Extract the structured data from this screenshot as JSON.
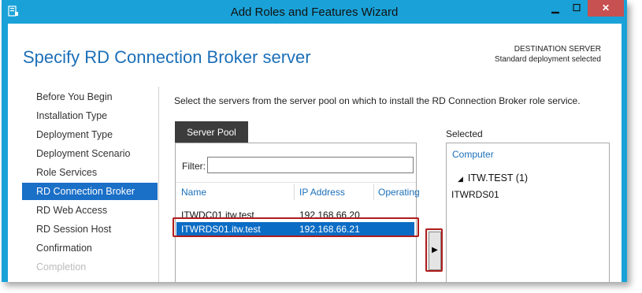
{
  "window": {
    "title": "Add Roles and Features Wizard",
    "minimize_glyph": "▁",
    "maximize_glyph": "☐",
    "close_glyph": "✕"
  },
  "page": {
    "heading": "Specify RD Connection Broker server",
    "destination_label": "DESTINATION SERVER",
    "destination_value": "Standard deployment selected"
  },
  "nav": {
    "items": [
      {
        "label": "Before You Begin",
        "state": "normal"
      },
      {
        "label": "Installation Type",
        "state": "normal"
      },
      {
        "label": "Deployment Type",
        "state": "normal"
      },
      {
        "label": "Deployment Scenario",
        "state": "normal"
      },
      {
        "label": "Role Services",
        "state": "normal"
      },
      {
        "label": "RD Connection Broker",
        "state": "active"
      },
      {
        "label": "RD Web Access",
        "state": "normal"
      },
      {
        "label": "RD Session Host",
        "state": "normal"
      },
      {
        "label": "Confirmation",
        "state": "normal"
      },
      {
        "label": "Completion",
        "state": "disabled"
      }
    ]
  },
  "content": {
    "instruction": "Select the servers from the server pool on which to install the RD Connection Broker role service.",
    "pool": {
      "tab_label": "Server Pool",
      "filter_label": "Filter:",
      "filter_value": "",
      "columns": [
        "Name",
        "IP Address",
        "Operating"
      ],
      "rows": [
        {
          "name": "ITWDC01.itw.test",
          "ip": "192.168.66.20",
          "selected": false
        },
        {
          "name": "ITWRDS01.itw.test",
          "ip": "192.168.66.21",
          "selected": true
        }
      ]
    },
    "add_button_glyph": "▶",
    "selected": {
      "label": "Selected",
      "column": "Computer",
      "group_label": "ITW.TEST (1)",
      "group_arrow": "◢",
      "items": [
        "ITWRDS01"
      ]
    }
  },
  "colors": {
    "frame": "#1aa2d8",
    "accent": "#1b6fb8",
    "nav_active": "#1a6fc7",
    "highlight_border": "#b01c1c"
  }
}
